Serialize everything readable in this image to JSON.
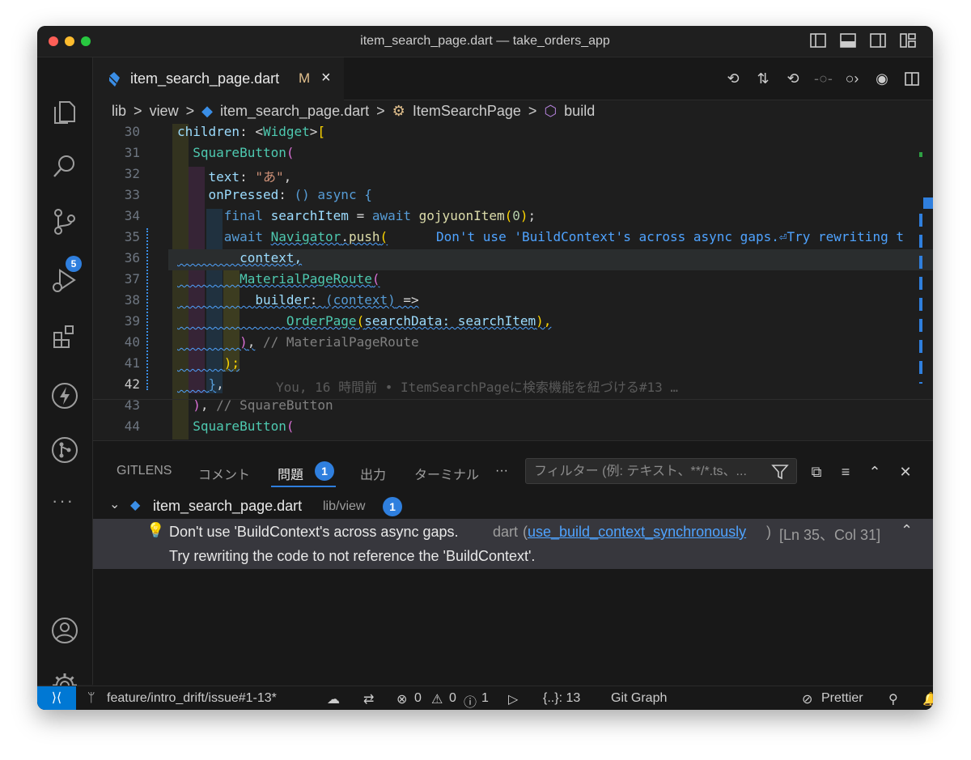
{
  "window": {
    "title": "item_search_page.dart — take_orders_app"
  },
  "activity_bar": {
    "source_control_badge": "5"
  },
  "tab": {
    "label": "item_search_page.dart",
    "modified": "M",
    "close": "×"
  },
  "breadcrumbs": {
    "sep": ">",
    "items": [
      "lib",
      "view",
      "item_search_page.dart",
      "ItemSearchPage",
      "build"
    ]
  },
  "editor": {
    "line_numbers": [
      "30",
      "31",
      "32",
      "33",
      "34",
      "35",
      "36",
      "37",
      "38",
      "39",
      "40",
      "41",
      "42",
      "43",
      "44"
    ],
    "current_line": "42",
    "inline_diagnostic": "Don't use 'BuildContext's across async gaps.⏎Try rewriting t",
    "blame": "You, 16 時間前 • ItemSearchPageに検索機能を紐づける#13 …"
  },
  "panel": {
    "tabs": [
      "GITLENS",
      "コメント",
      "問題",
      "出力",
      "ターミナル"
    ],
    "active_tab": "問題",
    "problem_count": "1",
    "more": "···",
    "filter_placeholder": "フィルター (例: テキスト、**/*.ts、...",
    "file": {
      "name": "item_search_page.dart",
      "path": "lib/view",
      "count": "1"
    },
    "problem": {
      "message": "Don't use 'BuildContext's across async gaps.",
      "source": "dart",
      "code": "use_build_context_synchronously",
      "location": "[Ln 35、Col 31]",
      "detail": "Try rewriting the code to not reference the 'BuildContext'."
    }
  },
  "statusbar": {
    "branch": "feature/intro_drift/issue#1-13*",
    "errors": "0",
    "warnings": "0",
    "info": "1",
    "symbols": "{..}: 13",
    "git_graph": "Git Graph",
    "prettier": "Prettier"
  },
  "colors": {
    "accent": "#2f7fde",
    "remote": "#0078d4",
    "modified": "#e2c08d",
    "wavy": "#4fa3ff"
  }
}
